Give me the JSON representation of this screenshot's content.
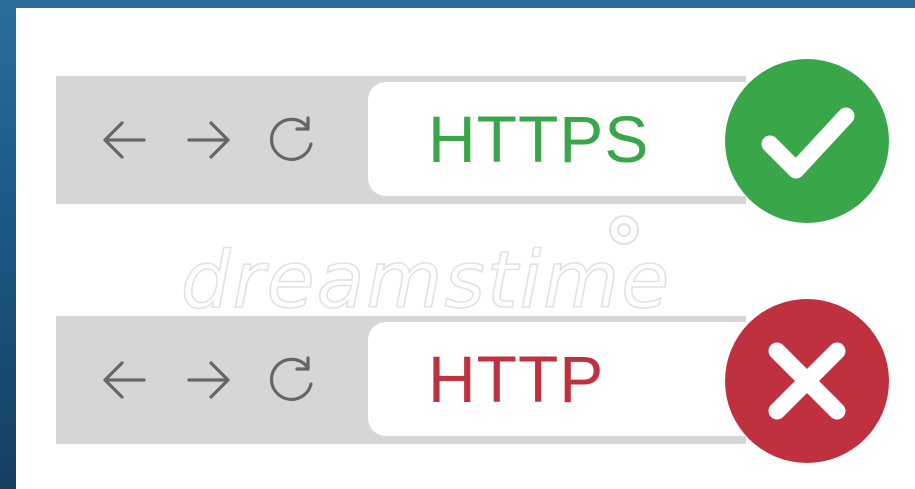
{
  "rows": [
    {
      "protocol": "HTTPS",
      "protocol_color": "#3aa64a",
      "status": "secure",
      "status_icon": "checkmark-icon",
      "status_color": "#3aa64a"
    },
    {
      "protocol": "HTTP",
      "protocol_color": "#c0313f",
      "status": "insecure",
      "status_icon": "cross-icon",
      "status_color": "#c0313f"
    }
  ],
  "nav_icons": [
    "back-arrow-icon",
    "forward-arrow-icon",
    "reload-icon"
  ],
  "watermark": "dreamstime"
}
